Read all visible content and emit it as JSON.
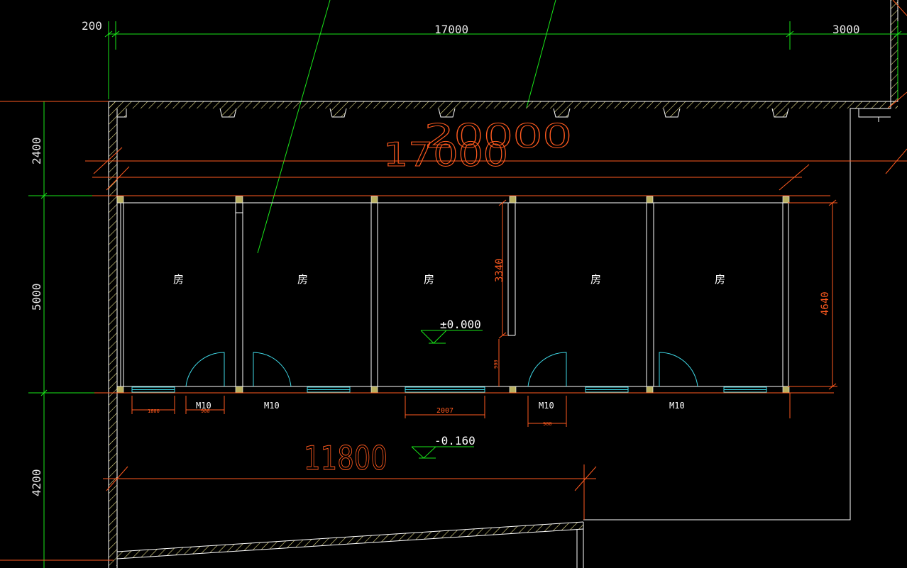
{
  "colors": {
    "background": "#000000",
    "wall": "#ffffff",
    "hatch": "#e8e08a",
    "dimension_green": "#19e619",
    "dimension_red": "#ff5a1f",
    "door_cyan": "#3fd8e6",
    "column": "#b8b060"
  },
  "top_dimensions": {
    "offset": "200",
    "main": "17000",
    "right": "3000"
  },
  "left_dimensions": {
    "upper": "2400",
    "middle": "5000",
    "lower": "4200"
  },
  "overlay_labels": {
    "big_upper_a": "20000",
    "big_upper_b": "17000",
    "big_lower": "11800",
    "partition_height": "3340",
    "right_height": "4640",
    "window_width": "2007",
    "small_ticks": [
      "1800",
      "900",
      "900",
      "900"
    ]
  },
  "rooms": [
    "房",
    "房",
    "房",
    "房",
    "房"
  ],
  "doors": [
    "M10",
    "M10",
    "M10",
    "M10"
  ],
  "levels": {
    "upper": "±0.000",
    "lower": "-0.160"
  }
}
